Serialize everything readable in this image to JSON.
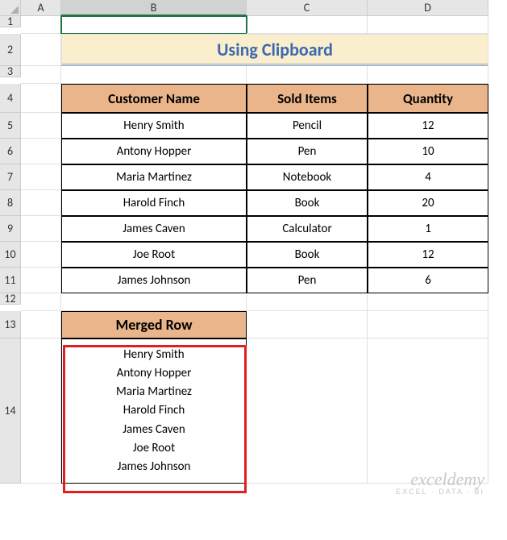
{
  "columns": [
    "",
    "A",
    "B",
    "C",
    "D"
  ],
  "rows": [
    "1",
    "2",
    "3",
    "4",
    "5",
    "6",
    "7",
    "8",
    "9",
    "10",
    "11",
    "12",
    "13",
    "14"
  ],
  "selectedColumn": "B",
  "title": "Using Clipboard",
  "table": {
    "headers": {
      "name": "Customer Name",
      "sold": "Sold Items",
      "qty": "Quantity"
    },
    "rows": [
      {
        "name": "Henry Smith",
        "sold": "Pencil",
        "qty": "12"
      },
      {
        "name": "Antony Hopper",
        "sold": "Pen",
        "qty": "10"
      },
      {
        "name": "Maria Martinez",
        "sold": "Notebook",
        "qty": "4"
      },
      {
        "name": "Harold Finch",
        "sold": "Book",
        "qty": "20"
      },
      {
        "name": "James Caven",
        "sold": "Calculator",
        "qty": "1"
      },
      {
        "name": "Joe Root",
        "sold": "Book",
        "qty": "12"
      },
      {
        "name": "James Johnson",
        "sold": "Pen",
        "qty": "6"
      }
    ]
  },
  "merged": {
    "header": "Merged Row",
    "content": "Henry Smith\nAntony Hopper\nMaria Martinez\nHarold Finch\nJames Caven\nJoe Root\nJames Johnson"
  },
  "watermark": {
    "main": "exceldemy",
    "sub": "EXCEL · DATA · BI"
  },
  "chart_data": {
    "type": "table",
    "title": "Using Clipboard",
    "columns": [
      "Customer Name",
      "Sold Items",
      "Quantity"
    ],
    "rows": [
      [
        "Henry Smith",
        "Pencil",
        12
      ],
      [
        "Antony Hopper",
        "Pen",
        10
      ],
      [
        "Maria Martinez",
        "Notebook",
        4
      ],
      [
        "Harold Finch",
        "Book",
        20
      ],
      [
        "James Caven",
        "Calculator",
        1
      ],
      [
        "Joe Root",
        "Book",
        12
      ],
      [
        "James Johnson",
        "Pen",
        6
      ]
    ]
  }
}
